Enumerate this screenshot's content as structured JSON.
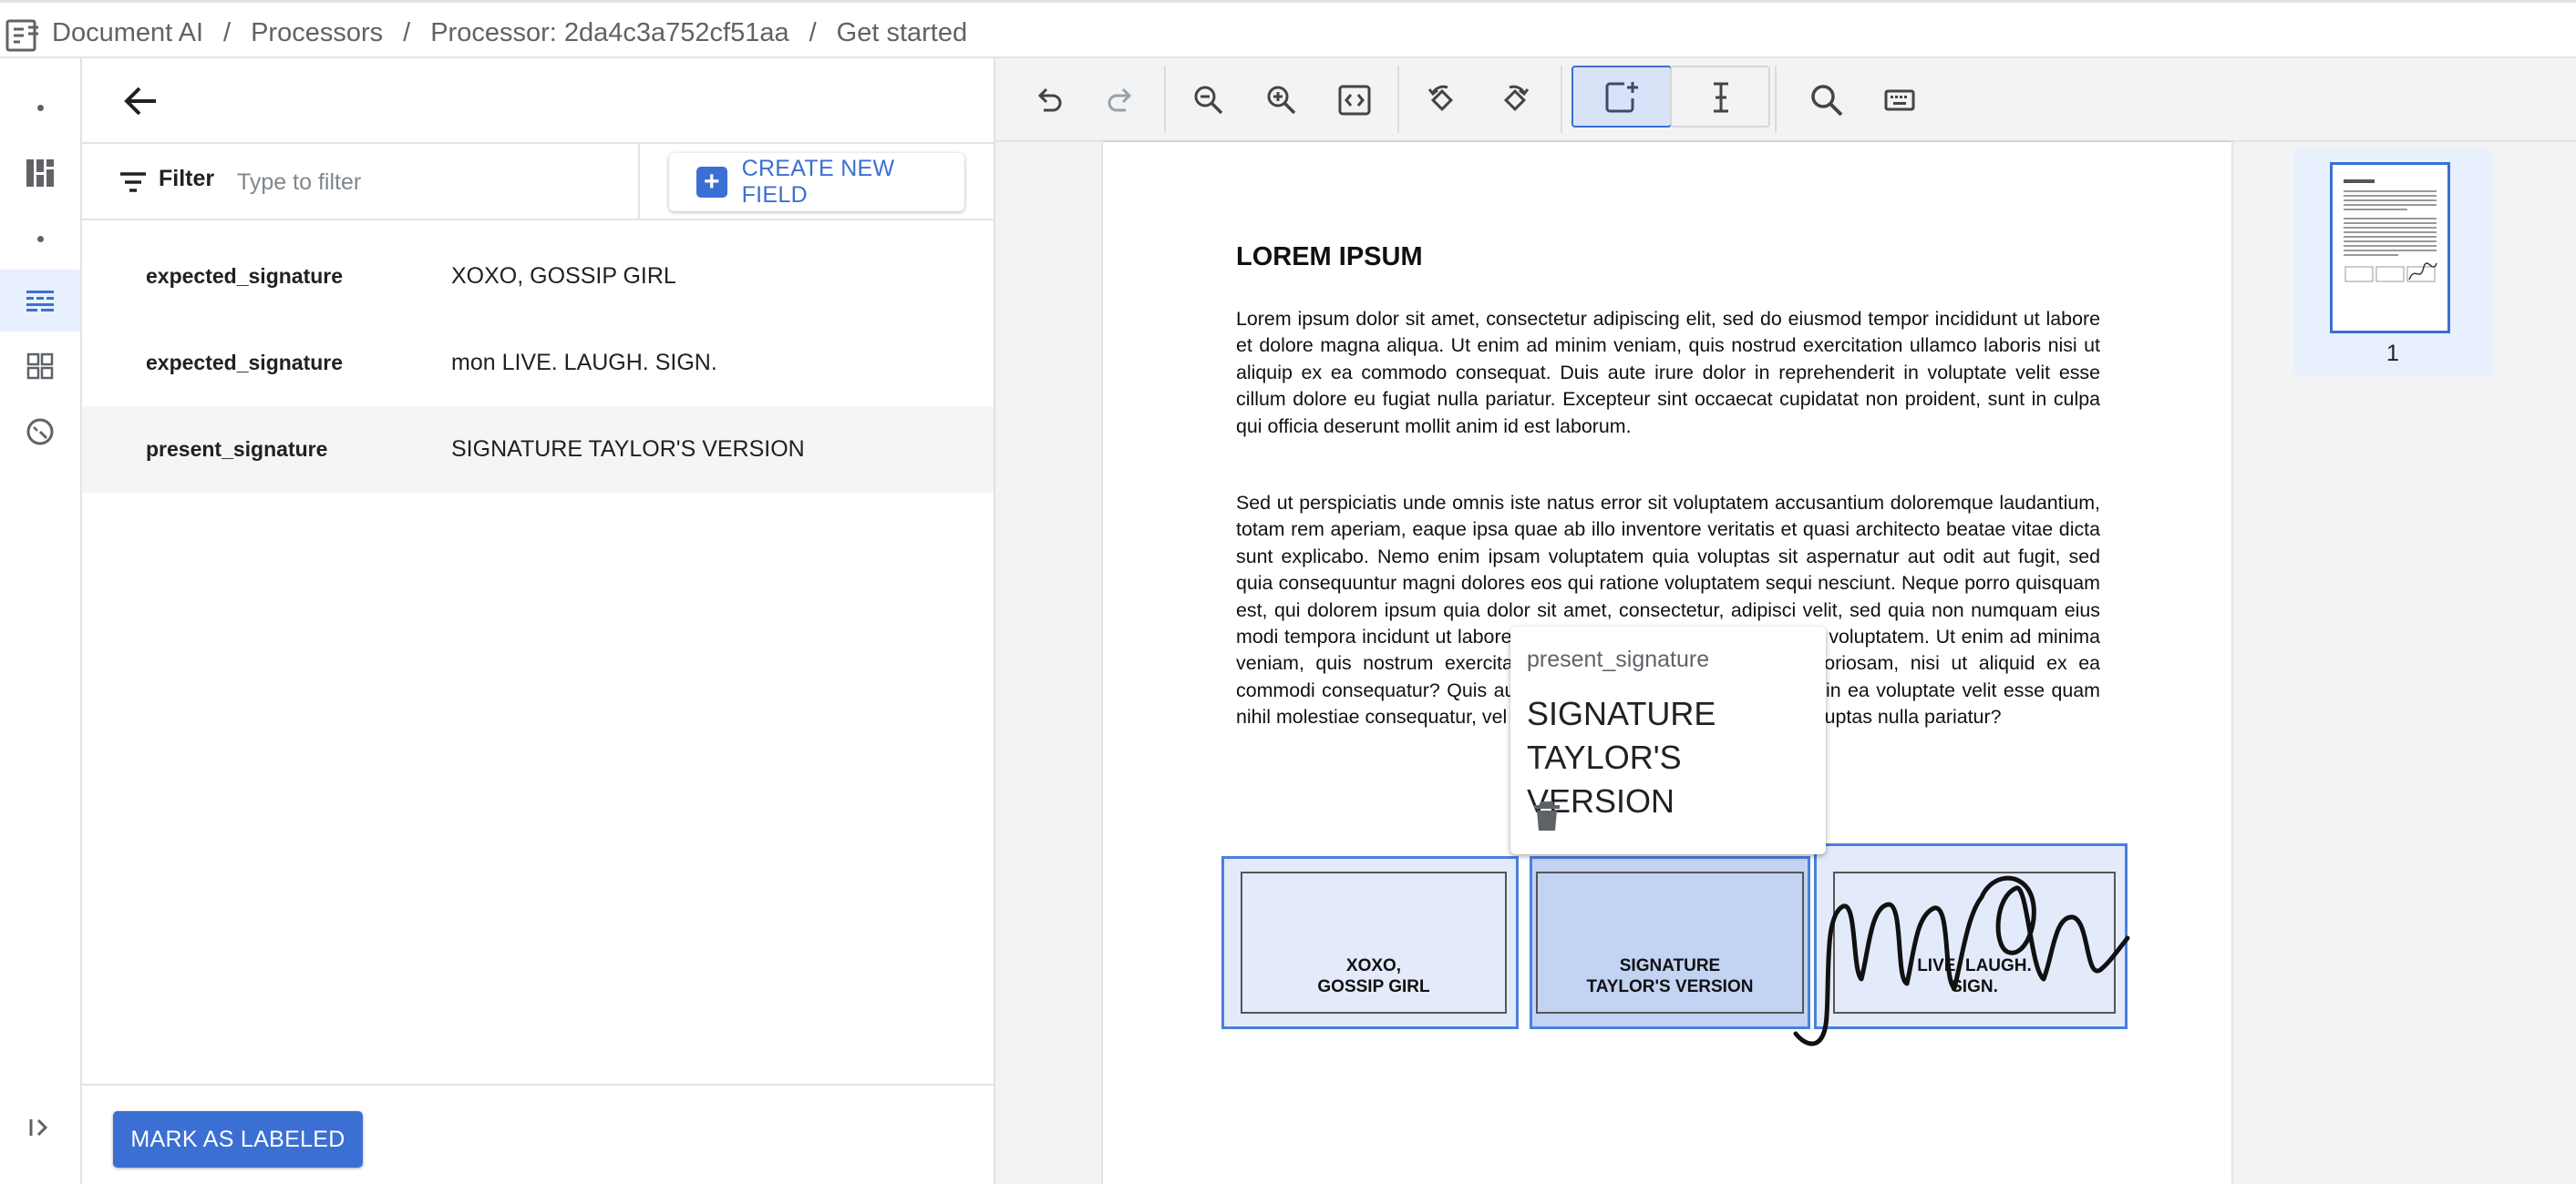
{
  "breadcrumb": {
    "items": [
      "Document AI",
      "Processors",
      "Processor: 2da4c3a752cf51aa",
      "Get started"
    ],
    "separator": "/"
  },
  "rail": {
    "icons": [
      "dot-icon",
      "dashboard-icon",
      "dot-icon",
      "labeling-icon",
      "grid-icon",
      "speed-icon",
      "expand-icon"
    ],
    "active": "labeling-icon"
  },
  "panel": {
    "filter_label": "Filter",
    "filter_placeholder": "Type to filter",
    "create_label": "CREATE NEW FIELD",
    "create_plus": "+",
    "fields": [
      {
        "name": "expected_signature",
        "value": "XOXO, GOSSIP GIRL"
      },
      {
        "name": "expected_signature",
        "value": "mon LIVE. LAUGH. SIGN."
      },
      {
        "name": "present_signature",
        "value": "SIGNATURE TAYLOR'S VERSION"
      }
    ],
    "selected_field": 2,
    "mark_label": "MARK AS LABELED"
  },
  "document": {
    "title": "LOREM IPSUM",
    "para1": "Lorem ipsum dolor sit amet, consectetur adipiscing elit, sed do eiusmod tempor incididunt ut labore et dolore magna aliqua. Ut enim ad minim veniam, quis nostrud exercitation ullamco laboris nisi ut aliquip ex ea commodo consequat. Duis aute irure dolor in reprehenderit in voluptate velit esse cillum dolore eu fugiat nulla pariatur. Excepteur sint occaecat cupidatat non proident, sunt in culpa qui officia deserunt mollit anim id est laborum.",
    "para2": "Sed ut perspiciatis unde omnis iste natus error sit voluptatem accusantium doloremque laudantium, totam rem aperiam, eaque ipsa quae ab illo inventore veritatis et quasi architecto beatae vitae dicta sunt explicabo. Nemo enim ipsam voluptatem quia voluptas sit aspernatur aut odit aut fugit, sed quia consequuntur magni dolores eos qui ratione voluptatem sequi nesciunt. Neque porro quisquam est, qui dolorem ipsum quia dolor sit amet, consectetur, adipisci velit, sed quia non numquam eius modi tempora incidunt ut labore et dolore magnam aliquam quaerat voluptatem. Ut enim ad minima veniam, quis nostrum exercitationem ullam corporis suscipit laboriosam, nisi ut aliquid ex ea commodi consequatur? Quis autem vel eum iure reprehenderit qui in ea voluptate velit esse quam nihil molestiae consequatur, vel illum qui dolorem eum fugiat quo voluptas nulla pariatur?",
    "sig1": "XOXO,\nGOSSIP GIRL",
    "sig2": "SIGNATURE\nTAYLOR'S VERSION",
    "sig3": "LIVE. LAUGH.\nSIGN."
  },
  "popup": {
    "type": "present_signature",
    "value": "SIGNATURE TAYLOR'S VERSION"
  },
  "thumbnails": {
    "page_number": "1"
  },
  "colors": {
    "accent": "#3b6fd4",
    "selected_bg": "#e8f0fe",
    "box_border": "#4a7fe0"
  }
}
